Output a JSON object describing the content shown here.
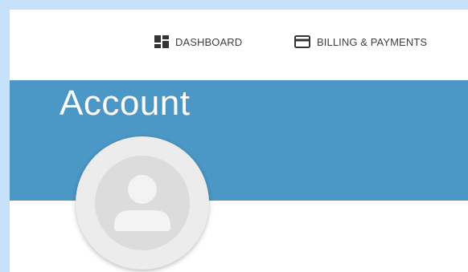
{
  "nav": {
    "items": [
      {
        "label": "DASHBOARD",
        "icon": "dashboard-icon"
      },
      {
        "label": "BILLING & PAYMENTS",
        "icon": "credit-card-icon"
      }
    ]
  },
  "page": {
    "title": "Account"
  },
  "profile": {
    "avatar_icon": "user-placeholder-icon"
  },
  "colors": {
    "page_background": "#c6e2fb",
    "hero_background": "#4b97c5",
    "avatar_background": "#ececec",
    "nav_text": "#3f3f3f"
  }
}
